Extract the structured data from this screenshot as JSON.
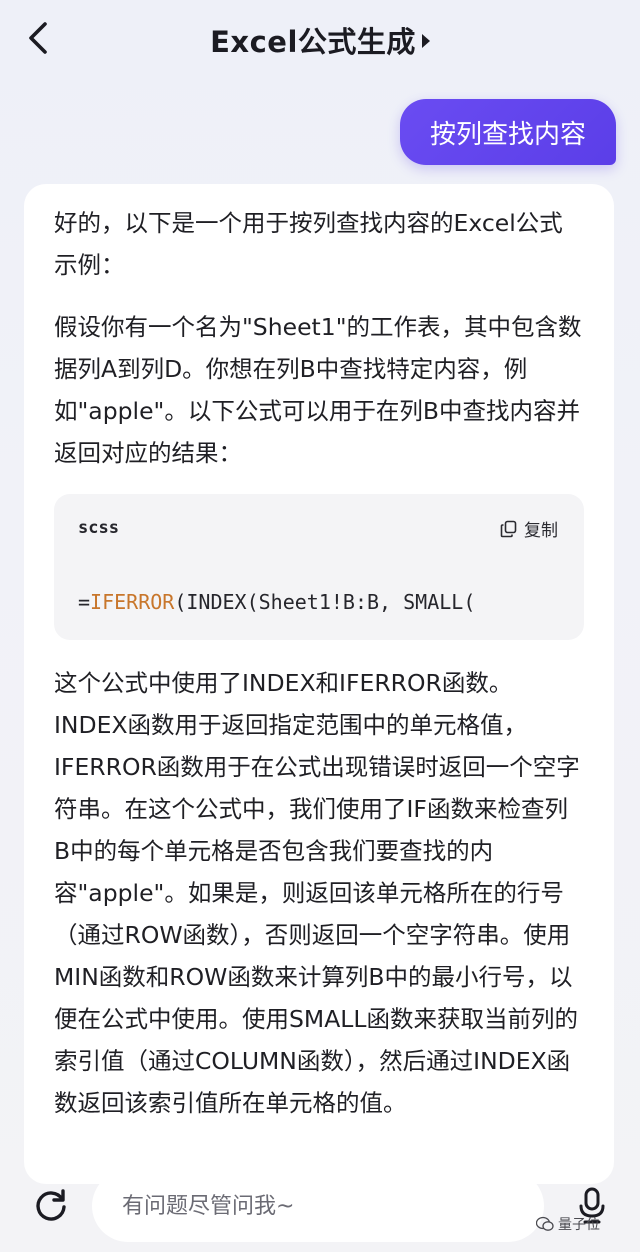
{
  "header": {
    "title": "Excel公式生成"
  },
  "chat": {
    "user_message": "按列查找内容",
    "reply": {
      "para1": "好的，以下是一个用于按列查找内容的Excel公式示例：",
      "para2": "假设你有一个名为\"Sheet1\"的工作表，其中包含数据列A到列D。你想在列B中查找特定内容，例如\"apple\"。以下公式可以用于在列B中查找内容并返回对应的结果：",
      "code": {
        "language": "scss",
        "copy_label": "复制",
        "prefix": "=",
        "keyword": "IFERROR",
        "rest": "(INDEX(Sheet1!B:B, SMALL("
      },
      "para3": "这个公式中使用了INDEX和IFERROR函数。INDEX函数用于返回指定范围中的单元格值，IFERROR函数用于在公式出现错误时返回一个空字符串。在这个公式中，我们使用了IF函数来检查列B中的每个单元格是否包含我们要查找的内容\"apple\"。如果是，则返回该单元格所在的行号（通过ROW函数），否则返回一个空字符串。使用MIN函数和ROW函数来计算列B中的最小行号，以便在公式中使用。使用SMALL函数来获取当前列的索引值（通过COLUMN函数），然后通过INDEX函数返回该索引值所在单元格的值。"
    }
  },
  "input": {
    "placeholder": "有问题尽管问我~"
  },
  "watermark": {
    "text": "量子位"
  },
  "icons": {
    "back": "chevron-left-icon",
    "refresh": "refresh-icon",
    "copy": "copy-icon",
    "mic": "microphone-icon"
  },
  "colors": {
    "accent": "#5b3ee8",
    "code_keyword": "#c8762b"
  }
}
